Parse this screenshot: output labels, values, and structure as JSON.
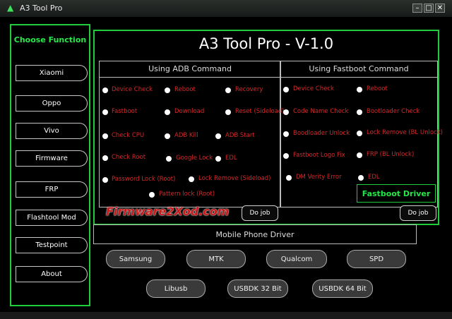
{
  "window": {
    "title": "A3 Tool Pro",
    "controls": [
      "–",
      "□",
      "✕"
    ]
  },
  "sidebar": {
    "title": "Choose Function",
    "items": [
      "Xiaomi",
      "Oppo",
      "Vivo",
      "Firmware",
      "FRP",
      "Flashtool Mod",
      "Testpoint",
      "About"
    ]
  },
  "main": {
    "title": "A3 Tool Pro - V-1.0",
    "adb": {
      "title": "Using ADB Command",
      "options": [
        "Device Check",
        "Reboot",
        "Recovery",
        "Fastboot",
        "Download",
        "Reset (Sideload)",
        "Check CPU",
        "ADB Kill",
        "ADB Start",
        "Check Root",
        "Google Lock",
        "EDL",
        "Password Lock (Root)",
        "Lock Remove (Sideload)",
        "Pattern lock (Root)"
      ],
      "do_job": "Do job"
    },
    "fastboot": {
      "title": "Using Fastboot Command",
      "options": [
        "Device Check",
        "Reboot",
        "Code Name Check",
        "Bootloader Check",
        "Boodloader Unlock",
        "Lock Remove (BL Unlock)",
        "Fastboot Logo Fix",
        "FRP (BL Unlock)",
        "DM Verity Error",
        "EDL"
      ],
      "driver_button": "Fastboot Driver",
      "do_job": "Do job"
    },
    "watermark": "Firmware2Xod.com"
  },
  "drivers": {
    "title": "Mobile Phone Driver",
    "buttons": [
      "Samsung",
      "MTK",
      "Qualcom",
      "SPD",
      "Libusb",
      "USBDK 32 Bit",
      "USBDK 64 Bit"
    ]
  }
}
